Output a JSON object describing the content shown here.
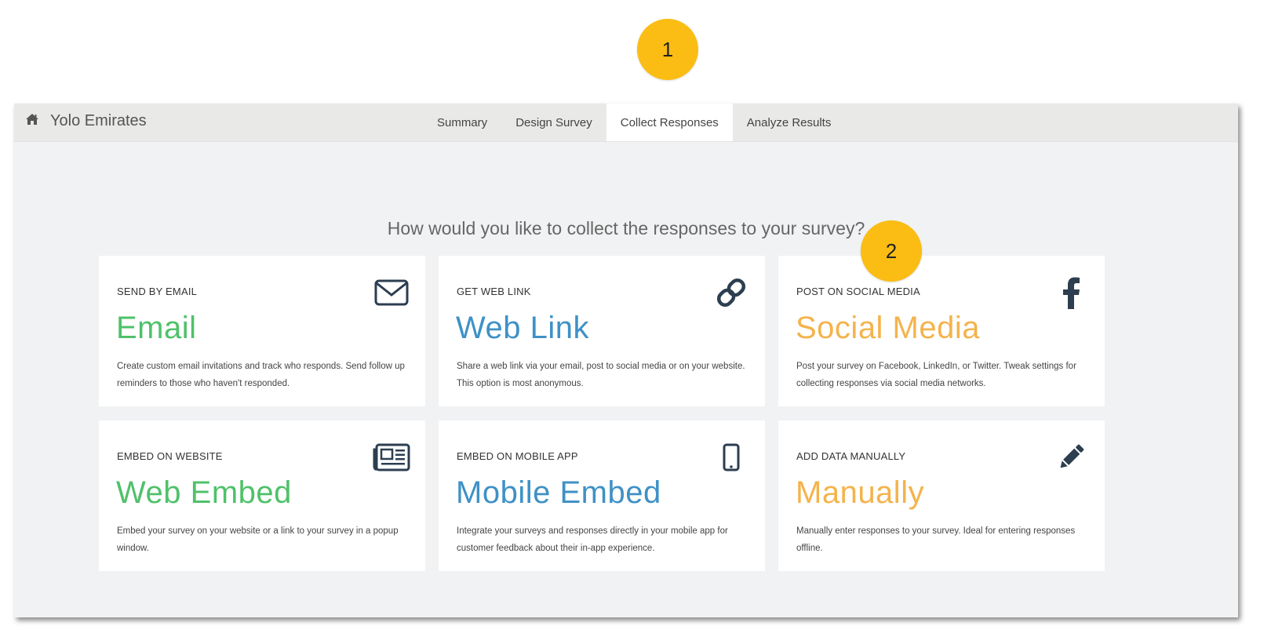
{
  "callouts": [
    "1",
    "2"
  ],
  "header": {
    "brand": "Yolo Emirates",
    "tabs": [
      "Summary",
      "Design Survey",
      "Collect Responses",
      "Analyze Results"
    ],
    "active_tab": "Collect Responses"
  },
  "question": "How would you like to collect the responses to your survey?",
  "cards": [
    {
      "kicker": "SEND BY EMAIL",
      "title": "Email",
      "desc": "Create custom email invitations and track who responds. Send follow up reminders to those who haven't responded.",
      "icon": "envelope-icon"
    },
    {
      "kicker": "GET WEB LINK",
      "title": "Web Link",
      "desc": "Share a web link via your email, post to social media or on your website. This option is most anonymous.",
      "icon": "link-icon"
    },
    {
      "kicker": "POST ON SOCIAL MEDIA",
      "title": "Social Media",
      "desc": "Post your survey on Facebook, LinkedIn, or Twitter. Tweak settings for collecting responses via social media networks.",
      "icon": "facebook-icon"
    },
    {
      "kicker": "EMBED ON WEBSITE",
      "title": "Web Embed",
      "desc": "Embed your survey on your website or a link to your survey in a popup window.",
      "icon": "newspaper-icon"
    },
    {
      "kicker": "EMBED ON MOBILE APP",
      "title": "Mobile Embed",
      "desc": "Integrate your surveys and responses directly in your mobile app for customer feedback about their in-app experience.",
      "icon": "mobile-phone-icon"
    },
    {
      "kicker": "ADD DATA MANUALLY",
      "title": "Manually",
      "desc": "Manually enter responses to your survey. Ideal for entering responses offline.",
      "icon": "pencil-icon"
    }
  ],
  "colors": {
    "green": "#4fc16a",
    "blue": "#3e91c6",
    "orange": "#f4b34c",
    "callout": "#fbbd14"
  }
}
